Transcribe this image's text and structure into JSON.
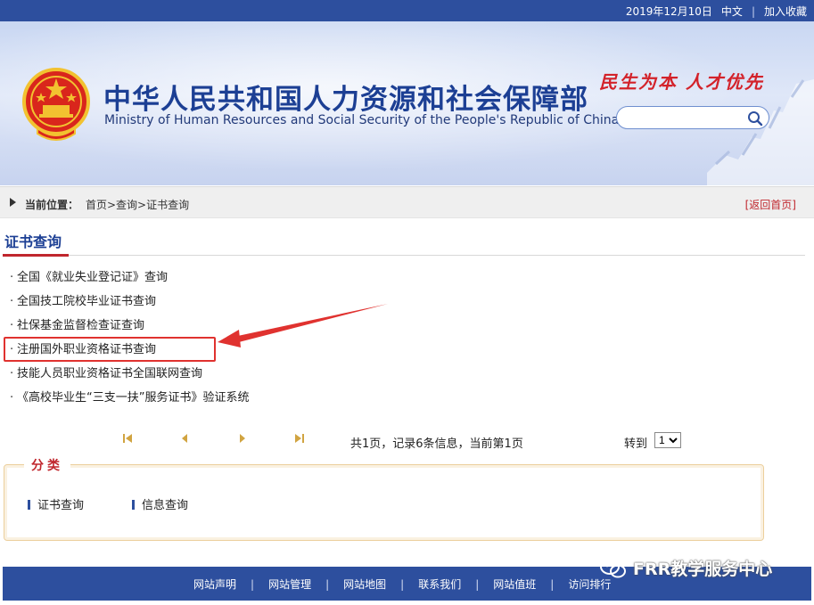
{
  "topbar": {
    "date": "2019年12月10日",
    "lang": "中文",
    "separator": "|",
    "favorite": "加入收藏"
  },
  "banner": {
    "title_cn": "中华人民共和国人力资源和社会保障部",
    "title_en": "Ministry of Human Resources and Social Security of the People's Republic of China",
    "slogan": "民生为本  人才优先",
    "search_value": "",
    "search_placeholder": ""
  },
  "breadcrumb": {
    "label": "当前位置：",
    "path": "首页>查询>证书查询",
    "back": "[返回首页]"
  },
  "section": {
    "title": "证书查询"
  },
  "list": {
    "bullet": "·",
    "items": [
      "全国《就业失业登记证》查询",
      "全国技工院校毕业证书查询",
      "社保基金监督检查证查询",
      "注册国外职业资格证书查询",
      "技能人员职业资格证书全国联网查询",
      "《高校毕业生“三支一扶”服务证书》验证系统"
    ]
  },
  "pager": {
    "info": "共1页，记录6条信息，当前第1页",
    "goto_label": "转到",
    "page_options": [
      "1"
    ],
    "selected_page": "1"
  },
  "category": {
    "title": "分类",
    "items": [
      "证书查询",
      "信息查询"
    ]
  },
  "footer": {
    "links": [
      "网站声明",
      "网站管理",
      "网站地图",
      "联系我们",
      "网站值班",
      "访问排行"
    ],
    "separator": "|"
  },
  "watermark": {
    "text": "FRR教学服务中心"
  },
  "colors": {
    "brand_blue": "#2d4f9e",
    "title_blue": "#1c3f94",
    "accent_red": "#c0262d",
    "highlight_red": "#e0322f"
  }
}
